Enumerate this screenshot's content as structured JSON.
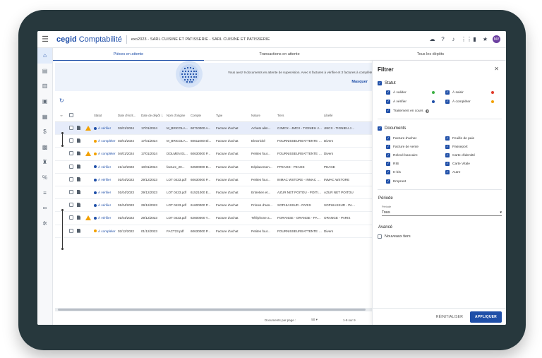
{
  "app": {
    "brand": "cegid",
    "product": "Comptabilité",
    "company": "exo2023 - SARL CUISINE ET PATISSERIE - SARL CUISINE ET PATISSERIE",
    "avatar": "MV"
  },
  "tabs": [
    {
      "label": "Pièces en attente"
    },
    {
      "label": "Transactions en attente"
    },
    {
      "label": "Tous les dépôts"
    }
  ],
  "banner": {
    "text": "Vous avez 9 documents en attente de supervision. Avec 6 factures à vérifier et 3 factures à compléter",
    "link": "Masquer"
  },
  "table": {
    "headers": {
      "statut": "Statut",
      "date_ecr": "Date d'écrit...",
      "date_depot": "Date de dépôt",
      "sort": "↓",
      "nom_origine": "Nom d'origine",
      "compte": "Compte",
      "type": "Type",
      "nature": "Nature",
      "tiers": "Tiers",
      "libelle": "Libellé"
    },
    "rows": [
      {
        "warn": true,
        "status": "À vérifier",
        "status_color": "#1f4fa8",
        "d1": "03/01/2024",
        "d2": "17/01/2024",
        "orig": "M_BRICOLA...",
        "compte": "60710000 A...",
        "type": "Facture d'achat",
        "nature": "Achats alim...",
        "tiers": "CJMCX - JMCX - TIGNIEU JA...",
        "lib": "JMCX - TIGNIEU JA..."
      },
      {
        "warn": false,
        "status": "À compléter",
        "status_color": "#f2a100",
        "d1": "03/01/2024",
        "d2": "17/01/2024",
        "orig": "M_BRICOLA...",
        "compte": "60611000 El...",
        "type": "Facture d'achat",
        "nature": "Electricité",
        "tiers": "FOURNISSEURSATTENTE - F...",
        "lib": "Divers"
      },
      {
        "warn": true,
        "status": "À compléter",
        "status_color": "#f2a100",
        "d1": "04/01/2024",
        "d2": "17/01/2024",
        "orig": "DOLMEN 01...",
        "compte": "60630000 P...",
        "type": "Facture d'achat",
        "nature": "Petites four...",
        "tiers": "FOURNISSEURSATTENTE - F...",
        "lib": "Divers"
      },
      {
        "warn": false,
        "status": "À vérifier",
        "status_color": "#1f4fa8",
        "d1": "21/12/2023",
        "d2": "10/01/2024",
        "orig": "facture_20...",
        "compte": "62500000 D...",
        "type": "Facture d'achat",
        "nature": "Déplacemen...",
        "tiers": "FPEAGE - PEAGE",
        "lib": "PEAGE"
      },
      {
        "warn": false,
        "status": "À vérifier",
        "status_color": "#1f4fa8",
        "d1": "01/04/2023",
        "d2": "29/12/2023",
        "orig": "LOT 0423.pdf",
        "compte": "60630000 P...",
        "type": "Facture d'achat",
        "nature": "Petites four...",
        "tiers": "INMAC WSTORE - INMAC W...",
        "lib": "INMAC WSTORE"
      },
      {
        "warn": false,
        "status": "À vérifier",
        "status_color": "#1f4fa8",
        "d1": "01/04/2023",
        "d2": "29/12/2023",
        "orig": "LOT 0423.pdf",
        "compte": "61521000 E...",
        "type": "Facture d'achat",
        "nature": "Entretien et...",
        "tiers": "AZUR NET POITOU - POITIE...",
        "lib": "AZUR NET POITOU"
      },
      {
        "warn": false,
        "status": "À vérifier",
        "status_color": "#1f4fa8",
        "d1": "01/04/2023",
        "d2": "29/12/2023",
        "orig": "LOT 0423.pdf",
        "compte": "61600000 P...",
        "type": "Facture d'achat",
        "nature": "Primes d'ass...",
        "tiers": "SOPHIASSUR - PARIS",
        "lib": "SOPHIASSUR - PARIS"
      },
      {
        "warn": true,
        "status": "À vérifier",
        "status_color": "#1f4fa8",
        "d1": "01/04/2023",
        "d2": "29/12/2023",
        "orig": "LOT 0423.pdf",
        "compte": "62600000 T...",
        "type": "Facture d'achat",
        "nature": "Téléphone a...",
        "tiers": "FORANGE - ORANGE - PARIS",
        "lib": "ORANGE - PARIS"
      },
      {
        "warn": false,
        "status": "À compléter",
        "status_color": "#f2a100",
        "d1": "02/12/2022",
        "d2": "01/12/2023",
        "orig": "FACT23.pdf",
        "compte": "60630000 P...",
        "type": "Facture d'achat",
        "nature": "Petites four...",
        "tiers": "FOURNISSEURSATTENTE - F...",
        "lib": "Divers"
      }
    ]
  },
  "footer": {
    "per_page_label": "Documents par page :",
    "per_page_value": "50",
    "per_page_arrow": "▾",
    "range": "1-9 sur 9"
  },
  "filter": {
    "title": "Filtrer",
    "statut": {
      "label": "Statut",
      "options": [
        {
          "label": "À valider",
          "color": "#3cb043"
        },
        {
          "label": "À saisir",
          "color": "#e03b2b"
        },
        {
          "label": "À vérifier",
          "color": "#1f4fa8"
        },
        {
          "label": "À compléter",
          "color": "#f2a100"
        },
        {
          "label": "Traitement en cours",
          "color": "#666666"
        }
      ]
    },
    "documents": {
      "label": "Documents",
      "options": [
        "Facture d'achat",
        "Feuille de paie",
        "Facture de vente",
        "Passeport",
        "Relevé bancaire",
        "Carte d'identité",
        "RIB",
        "Carte Vitale",
        "K-bis",
        "Autre",
        "Emprunt"
      ]
    },
    "periode": {
      "label": "Période",
      "select_label": "Période",
      "value": "Tous"
    },
    "avance": {
      "label": "Avancé",
      "option": "Nouveaux tiers"
    },
    "reset": "RÉINITIALISER",
    "apply": "APPLIQUER"
  }
}
